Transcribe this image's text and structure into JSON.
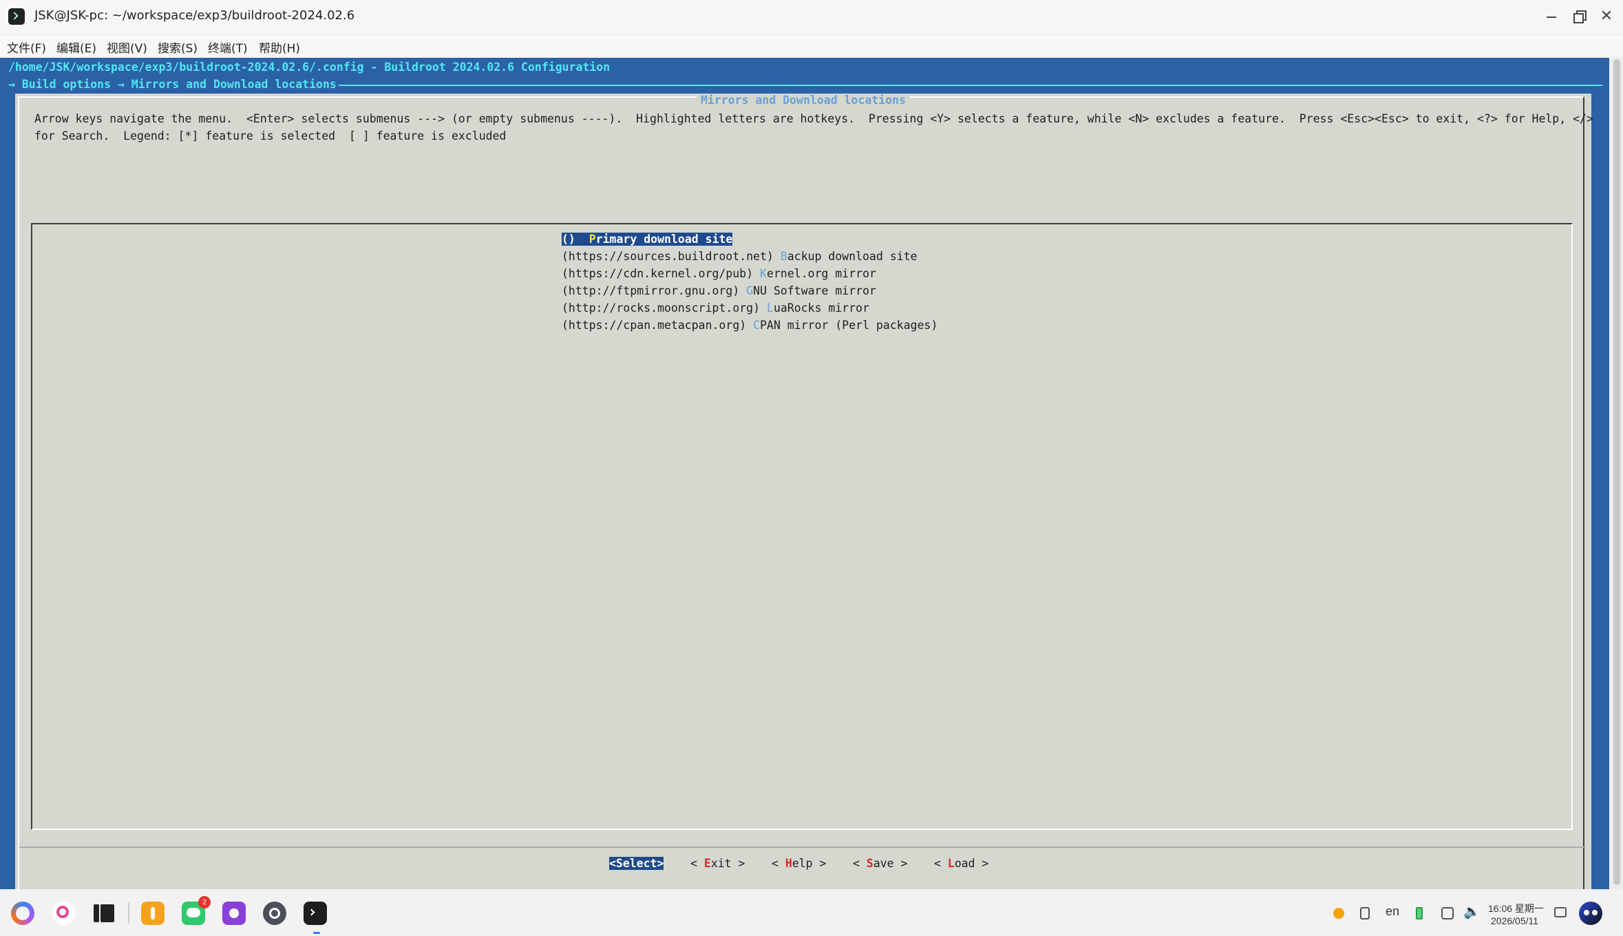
{
  "window": {
    "title": "JSK@JSK-pc: ~/workspace/exp3/buildroot-2024.02.6",
    "close_glyph": "✕"
  },
  "menubar": {
    "items": [
      "文件(F)",
      "编辑(E)",
      "视图(V)",
      "搜索(S)",
      "终端(T)",
      "帮助(H)"
    ]
  },
  "terminal": {
    "config_path": "/home/JSK/workspace/exp3/buildroot-2024.02.6/.config - Buildroot 2024.02.6 Configuration",
    "breadcrumb": "→ Build options → Mirrors and Download locations",
    "dialog_title": "Mirrors and Download locations",
    "help_line1": "Arrow keys navigate the menu.  <Enter> selects submenus ---> (or empty submenus ----).  Highlighted letters are hotkeys.  Pressing <Y> selects a feature, while <N> excludes a feature.  Press <Esc><Esc> to exit, <?> for Help, </>",
    "help_line2": "for Search.  Legend: [*] feature is selected  [ ] feature is excluded",
    "options": [
      {
        "value": "()",
        "hotkey": "P",
        "rest": "rimary download site"
      },
      {
        "value": "(https://sources.buildroot.net)",
        "hotkey": "B",
        "rest": "ackup download site"
      },
      {
        "value": "(https://cdn.kernel.org/pub)",
        "hotkey": "K",
        "rest": "ernel.org mirror"
      },
      {
        "value": "(http://ftpmirror.gnu.org)",
        "hotkey": "G",
        "rest": "NU Software mirror"
      },
      {
        "value": "(http://rocks.moonscript.org)",
        "hotkey": "L",
        "rest": "uaRocks mirror"
      },
      {
        "value": "(https://cpan.metacpan.org)",
        "hotkey": "C",
        "rest": "PAN mirror (Perl packages)"
      }
    ],
    "buttons": {
      "select": "<Select>",
      "exit_pre": "< ",
      "exit_hot": "E",
      "exit_rest": "xit >",
      "help_pre": "< ",
      "help_hot": "H",
      "help_rest": "elp >",
      "save_pre": "< ",
      "save_hot": "S",
      "save_rest": "ave >",
      "load_pre": "< ",
      "load_hot": "L",
      "load_rest": "oad >"
    }
  },
  "taskbar": {
    "notification_badge": "2",
    "language": "en",
    "time": "16:06 星期一",
    "date": "2026/05/11"
  },
  "colors": {
    "terminal_bg": "#2b62a6",
    "dialog_bg": "#d5d8cf",
    "accent_cyan": "#52e6f2",
    "hotkey_blue": "#6aa0d6",
    "selection_bg": "#1f4a8e",
    "button_hotkey_red": "#d12a2a"
  },
  "icons": [
    "app-terminal-icon",
    "minimize-icon",
    "maximize-icon",
    "close-icon",
    "launcher-icon",
    "search-icon",
    "multitask-icon",
    "app-store-icon",
    "chat-icon",
    "camera-icon",
    "settings-icon",
    "terminal-icon"
  ]
}
